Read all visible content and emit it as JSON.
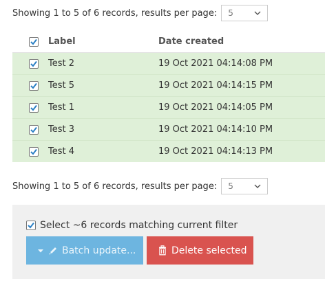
{
  "pagination_top": {
    "summary": "Showing 1 to 5 of 6 records,  results per page:",
    "per_page": "5"
  },
  "table": {
    "columns": {
      "label": "Label",
      "date": "Date created"
    },
    "header_checked": true,
    "rows": [
      {
        "label": "Test 2",
        "date": "19 Oct 2021 04:14:08 PM",
        "checked": true
      },
      {
        "label": "Test 5",
        "date": "19 Oct 2021 04:14:15 PM",
        "checked": true
      },
      {
        "label": "Test 1",
        "date": "19 Oct 2021 04:14:05 PM",
        "checked": true
      },
      {
        "label": "Test 3",
        "date": "19 Oct 2021 04:14:10 PM",
        "checked": true
      },
      {
        "label": "Test 4",
        "date": "19 Oct 2021 04:14:13 PM",
        "checked": true
      }
    ]
  },
  "pagination_bottom": {
    "summary": "Showing 1 to 5 of 6 records,  results per page:",
    "per_page": "5"
  },
  "batch": {
    "select_filter_label": "Select ~6 records matching current filter",
    "select_filter_checked": true,
    "batch_update_label": "Batch update...",
    "delete_label": "Delete selected"
  },
  "colors": {
    "selected_row": "#dff0d8",
    "checkbox_tick": "#2a7fc4",
    "batch_button": "#6db5e0",
    "delete_button": "#d9534f",
    "panel": "#f0f0f0"
  },
  "icons": [
    "chevron-down-icon",
    "checkbox-checked-icon",
    "caret-down-icon",
    "pencil-icon",
    "trash-icon"
  ]
}
